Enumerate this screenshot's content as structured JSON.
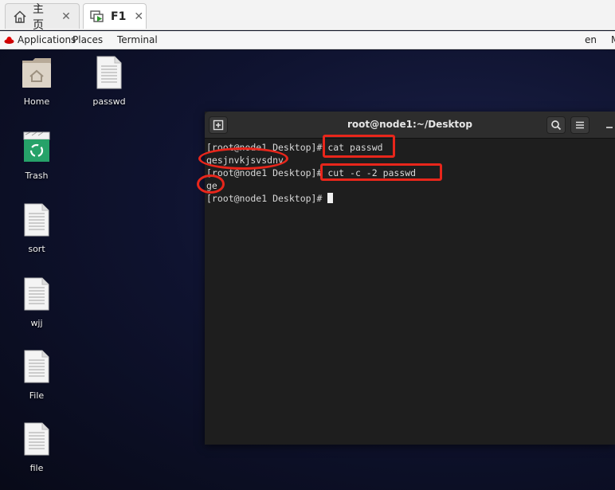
{
  "browser_tabs": [
    {
      "label": "主页",
      "icon": "home-icon",
      "active": false
    },
    {
      "label": "F1",
      "icon": "vm-console-icon",
      "active": true
    }
  ],
  "topbar": {
    "applications": "Applications",
    "places": "Places",
    "terminal": "Terminal",
    "lang": "en",
    "cut_letter": "M"
  },
  "desktop_icons": [
    {
      "label": "Home",
      "icon": "home-folder-icon"
    },
    {
      "label": "passwd",
      "icon": "text-file-icon"
    },
    {
      "label": "Trash",
      "icon": "trash-icon"
    },
    {
      "label": "sort",
      "icon": "text-file-icon"
    },
    {
      "label": "wjj",
      "icon": "text-file-icon"
    },
    {
      "label": "File",
      "icon": "text-file-icon"
    },
    {
      "label": "file",
      "icon": "text-file-icon"
    }
  ],
  "terminal": {
    "title": "root@node1:~/Desktop",
    "lines": [
      {
        "prompt": "[root@node1 Desktop]# ",
        "text": "cat passwd"
      },
      {
        "prompt": "",
        "text": "gesjnvkjsvsdnv"
      },
      {
        "prompt": "[root@node1 Desktop]# ",
        "text": "cut -c -2 passwd"
      },
      {
        "prompt": "",
        "text": "ge"
      },
      {
        "prompt": "[root@node1 Desktop]# ",
        "text": ""
      }
    ]
  },
  "colors": {
    "annotation_red": "#e8261b",
    "terminal_bg": "#1e1e1e",
    "header_bg": "#2d2d2d"
  }
}
